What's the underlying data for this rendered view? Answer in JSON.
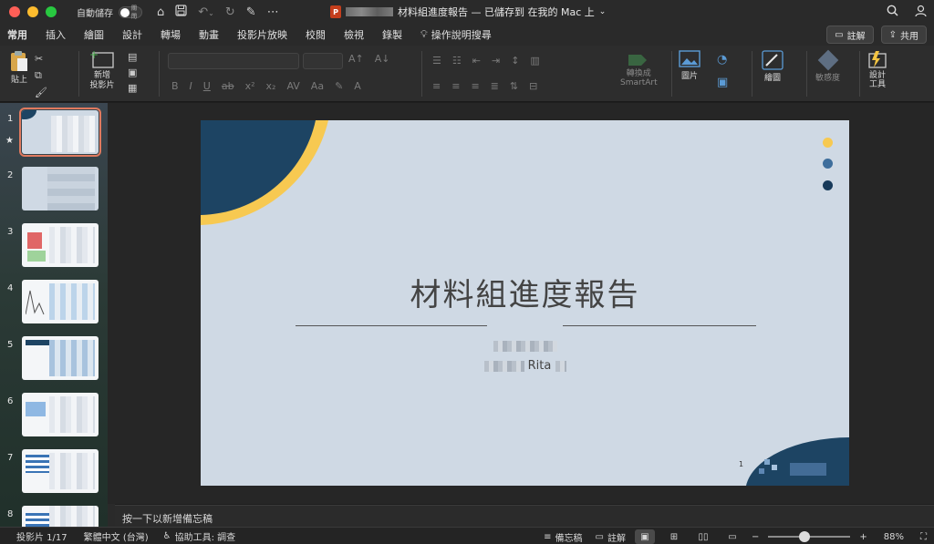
{
  "window": {
    "autosave_label": "自動儲存",
    "autosave_toggle": "關閉",
    "doc_title": "材料組進度報告 — 已儲存到 在我的 Mac 上",
    "ppt_badge": "P"
  },
  "tabs": [
    "常用",
    "插入",
    "繪圖",
    "設計",
    "轉場",
    "動畫",
    "投影片放映",
    "校閱",
    "檢視",
    "錄製"
  ],
  "tell_me": "操作說明搜尋",
  "ribbon_right": {
    "comments": "註解",
    "share": "共用"
  },
  "ribbon": {
    "paste": "貼上",
    "new_slide": "新增\n投影片",
    "convert_smartart": "轉換成\nSmartArt",
    "pictures": "圖片",
    "draw": "繪圖",
    "sensitivity": "敏感度",
    "designer": "設計\n工具"
  },
  "slides_panel": {
    "count_visible": [
      "1",
      "2",
      "3",
      "4",
      "5",
      "6",
      "7",
      "8"
    ],
    "star": "★"
  },
  "slide": {
    "title": "材料組進度報告",
    "presenter_suffix": "Rita",
    "slide_number": "1",
    "colors": {
      "background": "#cfd9e4",
      "navy": "#1d4463",
      "gold": "#f7c951",
      "mid_blue": "#3e6e9c",
      "dark_navy": "#183a5a"
    }
  },
  "notes_placeholder": "按一下以新增備忘稿",
  "status": {
    "slide_pos": "投影片 1/17",
    "language": "繁體中文 (台灣)",
    "accessibility": "協助工具: 調查",
    "notes_btn": "備忘稿",
    "comments_btn": "註解",
    "zoom": "88%"
  }
}
